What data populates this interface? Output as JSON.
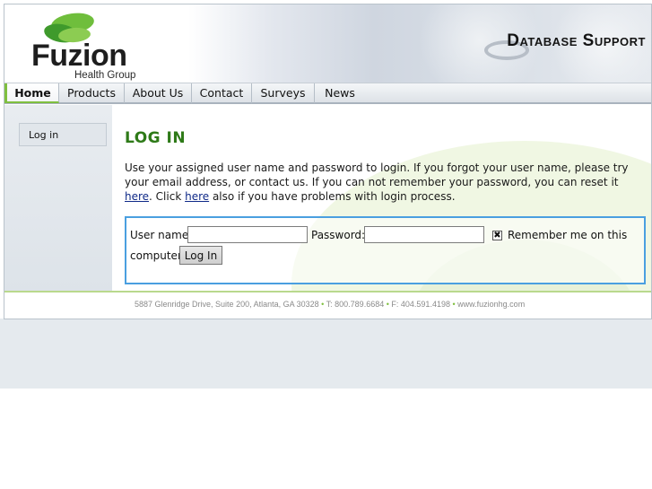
{
  "header": {
    "logo_name": "Fuzion",
    "logo_sub": "Health Group",
    "site_title": "Database Support"
  },
  "nav": {
    "items": [
      {
        "label": "Home",
        "active": true
      },
      {
        "label": "Products"
      },
      {
        "label": "About Us"
      },
      {
        "label": "Contact"
      },
      {
        "label": "Surveys"
      },
      {
        "label": "News"
      }
    ]
  },
  "sidebar": {
    "link": "Log in"
  },
  "main": {
    "title": "LOG IN",
    "intro_part1": "Use your assigned user name and password to login. If you forgot your user name, please try your email address, or contact us. If you can not remember your password, you can reset it ",
    "link1": "here",
    "intro_part2": ". Click ",
    "link2": "here",
    "intro_part3": " also if you have problems with login process."
  },
  "login": {
    "username_label": "User name:",
    "username_value": "",
    "password_label": "Password:",
    "password_value": "",
    "remember_label": "Remember me on this",
    "remember_label2": "computer",
    "remember_checked_glyph": "✖",
    "submit_label": "Log In"
  },
  "footer": {
    "address": "5887 Glenridge Drive, Suite 200, Atlanta, GA 30328",
    "phone": "T: 800.789.6684",
    "fax": "F: 404.591.4198",
    "web": "www.fuzionhg.com",
    "separator": "•"
  },
  "colors": {
    "accent_green": "#7fbf3f",
    "title_green": "#2e7a18",
    "box_blue": "#4a9fe0"
  }
}
